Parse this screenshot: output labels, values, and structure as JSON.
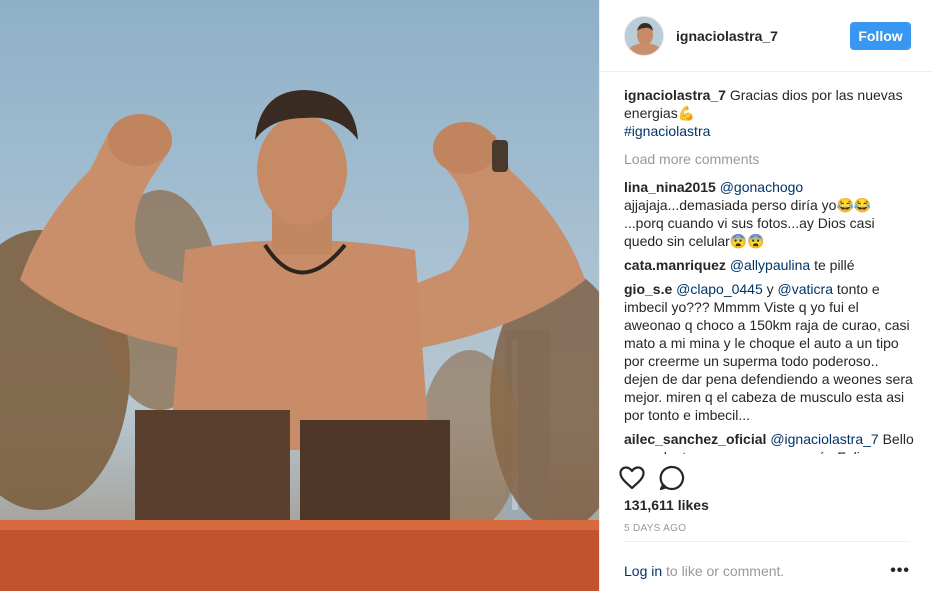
{
  "post": {
    "author": "ignaciolastra_7",
    "follow_label": "Follow",
    "caption": {
      "user": "ignaciolastra_7",
      "text": "Gracias dios por las nuevas energias💪",
      "hashtag": "#ignaciolastra"
    },
    "load_more_label": "Load more comments",
    "comments": [
      {
        "user": "lina_nina2015",
        "mention": "@gonachogo",
        "text": "ajjajaja...demasiada perso diría yo😂😂 ...porq cuando vi sus fotos...ay Dios casi quedo sin celular😨😨"
      },
      {
        "user": "cata.manriquez",
        "mention": "@allypaulina",
        "text": "te pillé"
      },
      {
        "user": "gio_s.e",
        "mention": "@clapo_0445",
        "connector": "y",
        "mention2": "@vaticra",
        "text": "tonto e imbecil yo??? Mmmm Viste q yo fui el aweonao q choco a 150km raja de curao, casi mato a mi mina y le choque el auto a un tipo por creerme un superma todo poderoso.. dejen de dar pena defendiendo a weones sera mejor. miren q el cabeza de musculo esta asi por tonto e imbecil..."
      },
      {
        "user": "ailec_sanchez_oficial",
        "mention": "@ignaciolastra_7",
        "text": "Bello para alante que eres un campeón Feliz"
      }
    ],
    "likes": "131,611 likes",
    "time_ago": "5 DAYS AGO",
    "login_link": "Log in",
    "login_rest": "to like or comment.",
    "more_label": "•••",
    "icons": {
      "like": "heart-icon",
      "comment": "comment-icon"
    }
  }
}
